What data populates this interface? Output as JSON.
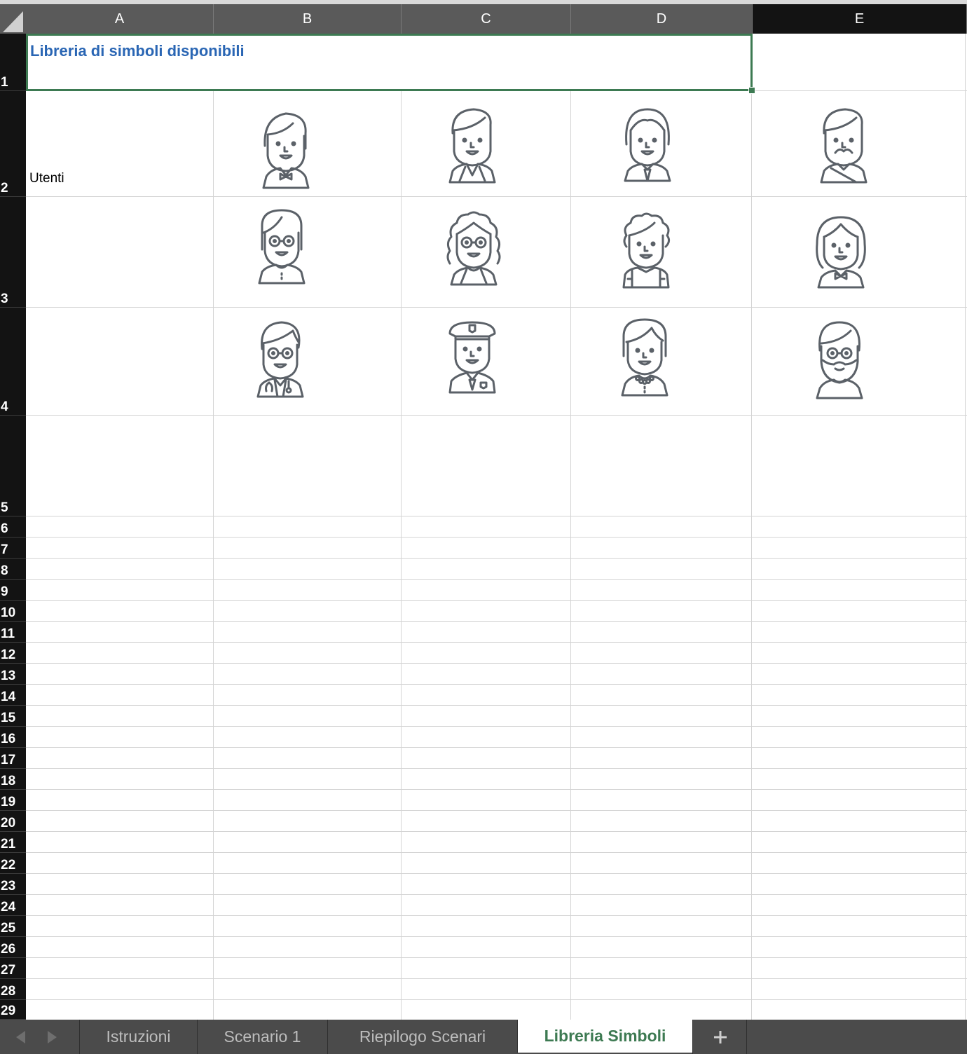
{
  "columns": [
    "A",
    "B",
    "C",
    "D",
    "E"
  ],
  "rows": [
    "1",
    "2",
    "3",
    "4",
    "5",
    "6",
    "7",
    "8",
    "9",
    "10",
    "11",
    "12",
    "13",
    "14",
    "15",
    "16",
    "17",
    "18",
    "19",
    "20",
    "21",
    "22",
    "23",
    "24",
    "25",
    "26",
    "27",
    "28",
    "29"
  ],
  "cells": {
    "a1_title": "Libreria di simboli disponibili",
    "a2_label": "Utenti"
  },
  "colors": {
    "title_text": "#2a66b4",
    "selection": "#3d7a52",
    "icon_stroke": "#5b6168",
    "header_bg": "#5a5a5a",
    "row_header_bg": "#131313",
    "tab_active_text": "#3d7a52"
  },
  "avatars": [
    {
      "cell": "B2",
      "icon": "man-bowtie-avatar-icon"
    },
    {
      "cell": "C2",
      "icon": "man-jacket-avatar-icon"
    },
    {
      "cell": "D2",
      "icon": "man-tie-avatar-icon"
    },
    {
      "cell": "E2",
      "icon": "man-mustache-avatar-icon"
    },
    {
      "cell": "B3",
      "icon": "woman-glasses-avatar-icon"
    },
    {
      "cell": "C3",
      "icon": "woman-curly-glasses-avatar-icon"
    },
    {
      "cell": "D3",
      "icon": "boy-backpack-avatar-icon"
    },
    {
      "cell": "E3",
      "icon": "woman-bowtie-avatar-icon"
    },
    {
      "cell": "B4",
      "icon": "doctor-avatar-icon"
    },
    {
      "cell": "C4",
      "icon": "police-officer-avatar-icon"
    },
    {
      "cell": "D4",
      "icon": "woman-necklace-avatar-icon"
    },
    {
      "cell": "E4",
      "icon": "man-beard-glasses-avatar-icon"
    }
  ],
  "tabs": [
    {
      "label": "Istruzioni",
      "active": false
    },
    {
      "label": "Scenario 1",
      "active": false
    },
    {
      "label": "Riepilogo Scenari",
      "active": false
    },
    {
      "label": "Libreria Simboli",
      "active": true
    }
  ],
  "icons": {
    "prev_sheet": "triangle-left-icon",
    "next_sheet": "triangle-right-icon",
    "add_sheet": "plus-icon"
  }
}
